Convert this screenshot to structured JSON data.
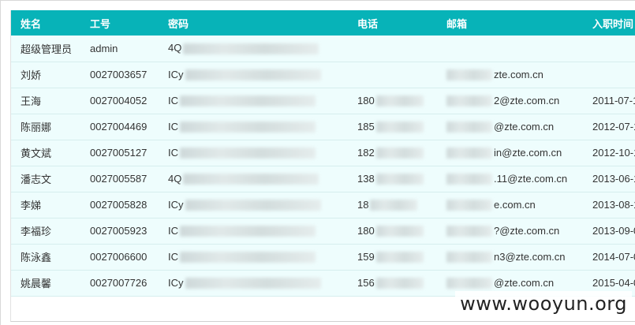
{
  "table": {
    "headers": [
      "姓名",
      "工号",
      "密码",
      "电话",
      "邮箱",
      "入职时间"
    ],
    "rows": [
      {
        "name": "超级管理员",
        "id": "admin",
        "pw": "4Q",
        "phone": "",
        "mail": "",
        "date": ""
      },
      {
        "name": "刘娇",
        "id": "0027003657",
        "pw": "ICy",
        "phone": "",
        "mail": "zte.com.cn",
        "date": ""
      },
      {
        "name": "王海",
        "id": "0027004052",
        "pw": "IC",
        "phone": "180",
        "mail": "2@zte.com.cn",
        "date": "2011-07-1"
      },
      {
        "name": "陈丽娜",
        "id": "0027004469",
        "pw": "IC",
        "phone": "185",
        "mail": "@zte.com.cn",
        "date": "2012-07-1"
      },
      {
        "name": "黄文斌",
        "id": "0027005127",
        "pw": "IC",
        "phone": "182",
        "mail": "in@zte.com.cn",
        "date": "2012-10-1"
      },
      {
        "name": "潘志文",
        "id": "0027005587",
        "pw": "4Q",
        "phone": "138",
        "mail": ".11@zte.com.cn",
        "date": "2013-06-1"
      },
      {
        "name": "李娣",
        "id": "0027005828",
        "pw": "ICy",
        "phone": "18",
        "mail": "e.com.cn",
        "date": "2013-08-1"
      },
      {
        "name": "李福珍",
        "id": "0027005923",
        "pw": "IC",
        "phone": "180",
        "mail": "?@zte.com.cn",
        "date": "2013-09-0"
      },
      {
        "name": "陈泳鑫",
        "id": "0027006600",
        "pw": "IC",
        "phone": "159",
        "mail": "n3@zte.com.cn",
        "date": "2014-07-0"
      },
      {
        "name": "姚晨馨",
        "id": "0027007726",
        "pw": "ICy",
        "phone": "156",
        "mail": "@zte.com.cn",
        "date": "2015-04-0"
      }
    ]
  },
  "watermark": "www.wooyun.org",
  "colors": {
    "header_bg": "#07b3b8",
    "row_bg": "#eefdfd"
  }
}
